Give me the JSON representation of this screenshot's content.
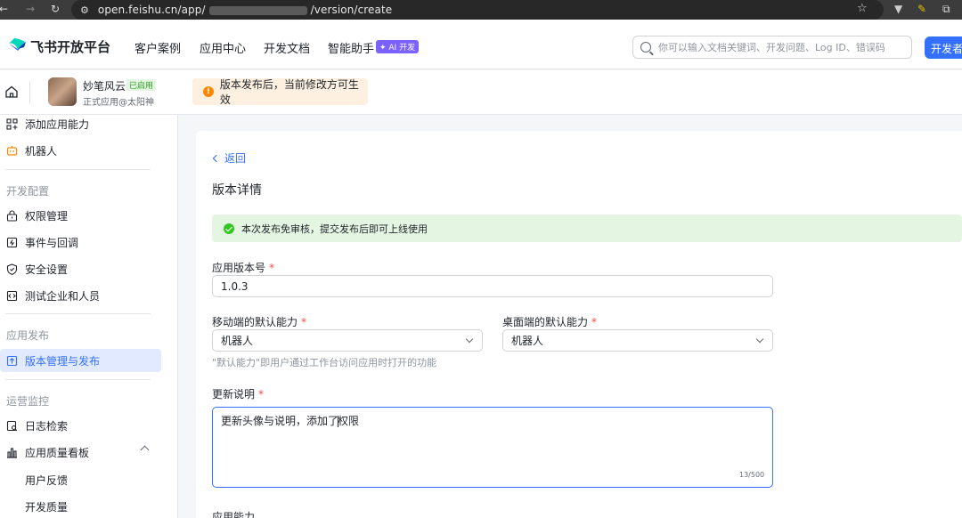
{
  "browser": {
    "url_prefix": "open.feishu.cn/app/",
    "url_suffix": "/version/create"
  },
  "topnav": {
    "logo": "飞书开放平台",
    "links": [
      "客户案例",
      "应用中心",
      "开发文档",
      "智能助手"
    ],
    "ai_badge": "✦ AI 开发",
    "search_placeholder": "你可以输入文档关键词、开发问题、Log ID、错误码",
    "dev_button": "开发者后台"
  },
  "appbar": {
    "app_name": "妙笔风云",
    "status_badge": "已启用",
    "subtitle": "正式应用@太阳神",
    "notice": "版本发布后，当前修改方可生效"
  },
  "sidebar": {
    "add_capability": "添加应用能力",
    "robot": "机器人",
    "group_dev": "开发配置",
    "permission": "权限管理",
    "events": "事件与回调",
    "security": "安全设置",
    "test_org": "测试企业和人员",
    "group_release": "应用发布",
    "version_release": "版本管理与发布",
    "group_ops": "运营监控",
    "log_search": "日志检索",
    "quality_board": "应用质量看板",
    "user_feedback": "用户反馈",
    "dev_quality": "开发质量"
  },
  "main": {
    "back": "返回",
    "title": "版本详情",
    "success_message": "本次发布免审核，提交发布后即可上线使用",
    "version_label": "应用版本号",
    "version_value": "1.0.3",
    "mobile_label": "移动端的默认能力",
    "mobile_value": "机器人",
    "desktop_label": "桌面端的默认能力",
    "desktop_value": "机器人",
    "hint": "\"默认能力\"即用户通过工作台访问应用时打开的功能",
    "notes_label": "更新说明",
    "notes_before_caret": "更新头像与说明，添加了",
    "notes_after_caret": "权限",
    "counter": "13/500",
    "capability_label": "应用能力",
    "required_mark": "*"
  }
}
